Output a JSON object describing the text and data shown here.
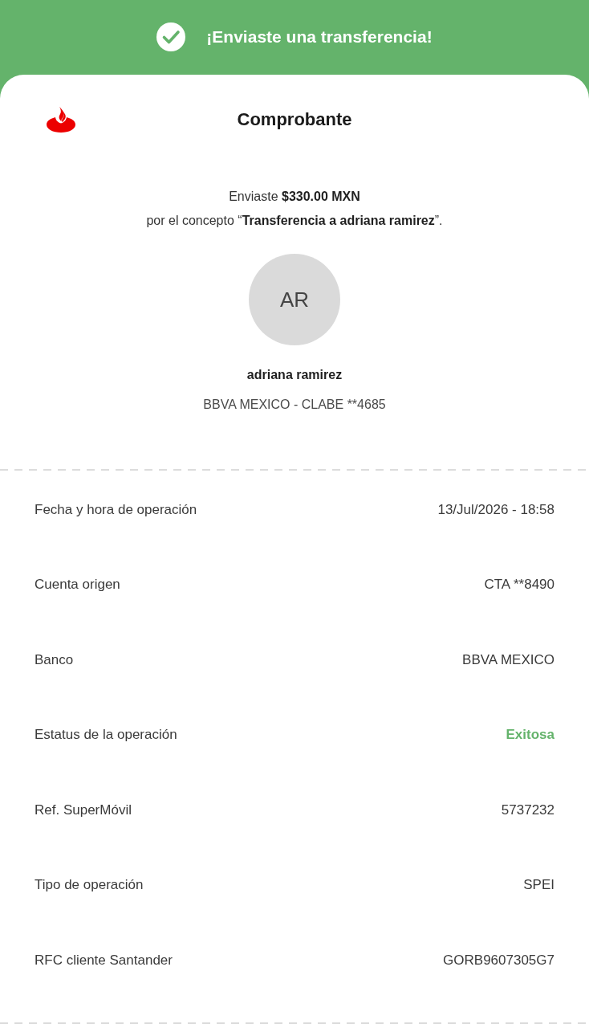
{
  "header": {
    "title": "¡Enviaste una transferencia!"
  },
  "receipt": {
    "title": "Comprobante",
    "summary": [
      "Enviaste **$330.00 MXN**",
      "por el concepto “**Transferencia a adriana ramirez**”."
    ],
    "recipient": {
      "initials": "AR",
      "name": "adriana ramirez",
      "account": "BBVA MEXICO - CLABE **4685"
    },
    "details": [
      {
        "kind": "plain",
        "label": "Fecha y hora de operación",
        "value": "13/Jul/2026 - 18:58"
      },
      {
        "kind": "plain",
        "label": "Cuenta origen",
        "value": "CTA **8490"
      },
      {
        "kind": "plain",
        "label": "Banco",
        "value": "BBVA MEXICO"
      },
      {
        "kind": "status",
        "label": "Estatus de la operación",
        "value": "Exitosa"
      },
      {
        "kind": "plain",
        "label": "Ref. SuperMóvil",
        "value": "5737232"
      },
      {
        "kind": "plain",
        "label": "Tipo de operación",
        "value": "SPEI"
      },
      {
        "kind": "plain",
        "label": "RFC cliente Santander",
        "value": "GORB9607305G7"
      }
    ]
  }
}
